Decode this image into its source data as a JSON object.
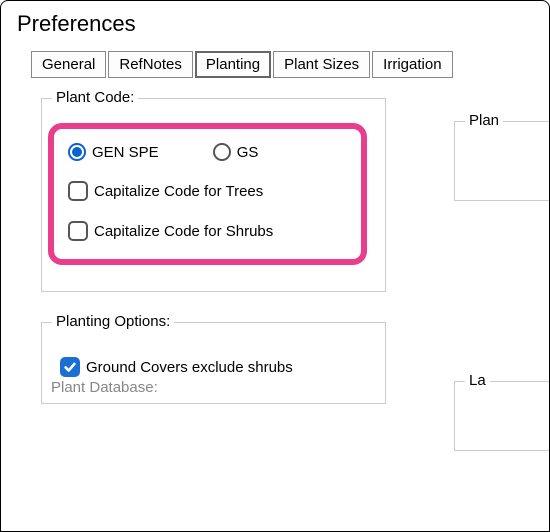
{
  "window": {
    "title": "Preferences"
  },
  "tabs": [
    {
      "label": "General",
      "active": false
    },
    {
      "label": "RefNotes",
      "active": false
    },
    {
      "label": "Planting",
      "active": true
    },
    {
      "label": "Plant Sizes",
      "active": false
    },
    {
      "label": "Irrigation",
      "active": false
    }
  ],
  "plantCode": {
    "legend": "Plant Code:",
    "radioGenSpe": {
      "label": "GEN SPE",
      "checked": true
    },
    "radioGs": {
      "label": "GS",
      "checked": false
    },
    "capTrees": {
      "label": "Capitalize Code for Trees",
      "checked": false
    },
    "capShrubs": {
      "label": "Capitalize Code for Shrubs",
      "checked": false
    }
  },
  "plantingOptions": {
    "legend": "Planting Options:",
    "gcExcludeShrubs": {
      "label": "Ground Covers exclude shrubs",
      "checked": true
    }
  },
  "sideGroups": {
    "plan": "Plan",
    "la": "La"
  },
  "cutoff": "Plant Database:"
}
